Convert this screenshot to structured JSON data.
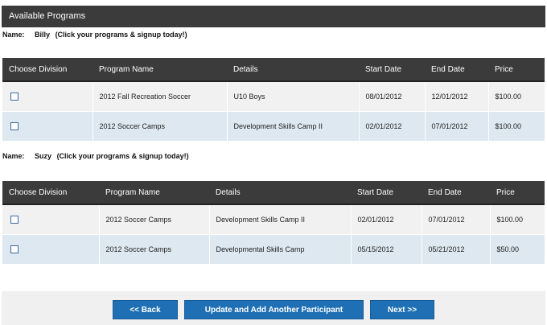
{
  "header": {
    "title": "Available Programs"
  },
  "name_label": "Name:",
  "columns1": [
    "Choose Division",
    "Program Name",
    "Details",
    "Start Date",
    "End Date",
    "Price"
  ],
  "columns2": [
    "Choose Division",
    "Program Name",
    "Details",
    "Start Date",
    "End Date",
    "Price"
  ],
  "participants": [
    {
      "name": "Billy",
      "cta": "(Click your programs & signup today!)",
      "rows": [
        {
          "program": "2012 Fall Recreation Soccer",
          "details": "U10 Boys",
          "start": "08/01/2012",
          "end": "12/01/2012",
          "price": "$100.00"
        },
        {
          "program": "2012 Soccer Camps",
          "details": "Development Skills Camp II",
          "start": "02/01/2012",
          "end": "07/01/2012",
          "price": "$100.00"
        }
      ]
    },
    {
      "name": "Suzy",
      "cta": "(Click your programs & signup today!)",
      "rows": [
        {
          "program": "2012 Soccer Camps",
          "details": "Development Skills Camp II",
          "start": "02/01/2012",
          "end": "07/01/2012",
          "price": "$100.00"
        },
        {
          "program": "2012 Soccer Camps",
          "details": "Developmental Skills Camp",
          "start": "05/15/2012",
          "end": "05/21/2012",
          "price": "$50.00"
        }
      ]
    }
  ],
  "buttons": {
    "back": "<< Back",
    "update": "Update and Add Another Participant",
    "next": "Next >>"
  },
  "colors": {
    "header_bg": "#3b3b3b",
    "row_light": "#f1f1f1",
    "row_blue": "#dde8f0",
    "button": "#1f6fb4"
  }
}
